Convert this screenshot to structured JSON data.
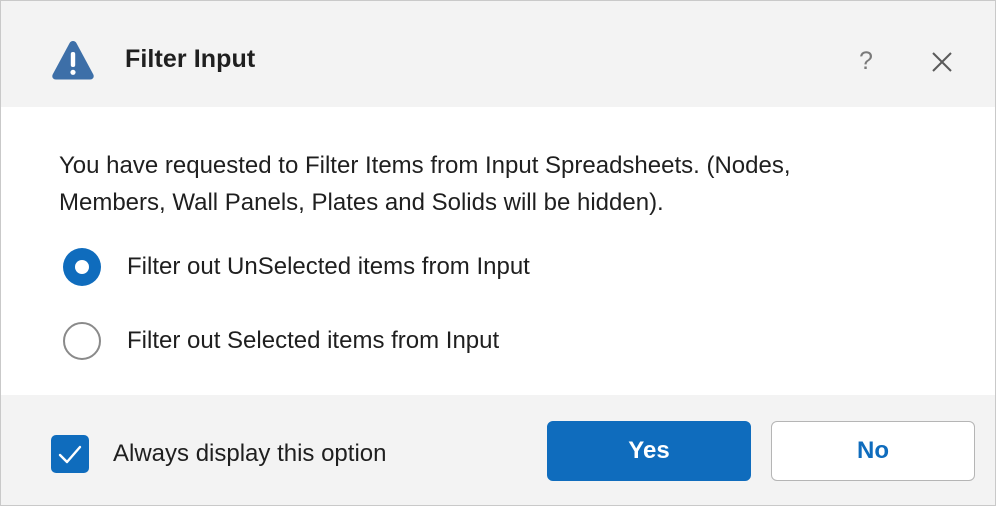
{
  "dialog": {
    "title": "Filter Input",
    "help_label": "?",
    "icons": {
      "warning": "warning-triangle-icon",
      "close": "close-icon",
      "help": "help-icon",
      "check": "checkmark-icon"
    },
    "colors": {
      "accent": "#0f6cbd",
      "warning": "#3d6fa8",
      "titlebar_bg": "#f3f3f3",
      "footer_bg": "#f3f3f3"
    }
  },
  "message": {
    "line1": "You have requested to Filter Items from Input Spreadsheets. (Nodes,",
    "line2": "Members, Wall Panels, Plates and Solids will be hidden)."
  },
  "options": [
    {
      "label": "Filter out UnSelected items from Input",
      "selected": true
    },
    {
      "label": "Filter out Selected items from Input",
      "selected": false
    }
  ],
  "footer": {
    "always_display_label": "Always display this option",
    "always_display_checked": true,
    "yes_label": "Yes",
    "no_label": "No"
  }
}
